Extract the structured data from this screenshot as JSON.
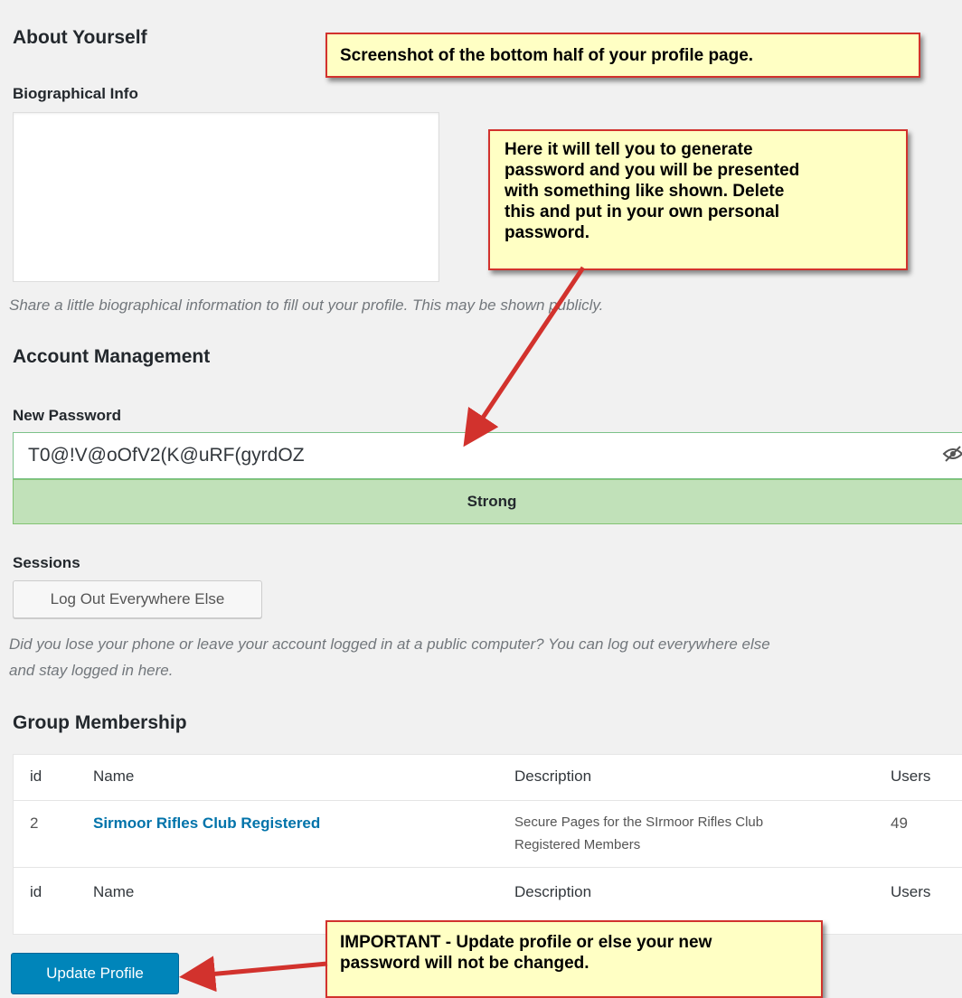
{
  "about": {
    "heading": "About Yourself",
    "bio_label": "Biographical Info",
    "bio_value": "",
    "bio_description": "Share a little biographical information to fill out your profile. This may be shown publicly."
  },
  "account": {
    "heading": "Account Management",
    "password_label": "New Password",
    "password_value": "T0@!V@oOfV2(K@uRF(gyrdOZ",
    "strength": "Strong",
    "sessions_label": "Sessions",
    "logout_button": "Log Out Everywhere Else",
    "sessions_description_line1": "Did you lose your phone or leave your account logged in at a public computer? You can log out everywhere else",
    "sessions_description_line2": "and stay logged in here."
  },
  "group": {
    "heading": "Group Membership",
    "columns": [
      "id",
      "Name",
      "Description",
      "Users"
    ],
    "rows": [
      {
        "id": "2",
        "name": "Sirmoor Rifles Club Registered",
        "description_line1": "Secure Pages for the SIrmoor Rifles Club",
        "description_line2": "Registered Members",
        "users": "49"
      }
    ],
    "footer": [
      "id",
      "Name",
      "Description",
      "Users"
    ]
  },
  "update_button": "Update Profile",
  "callouts": {
    "top": "Screenshot of the bottom half of your profile page.",
    "middle_line1": "Here it will tell you to generate",
    "middle_line2": "password and you will be presented",
    "middle_line3": "with something like shown.  Delete",
    "middle_line4": "this and put in your own personal",
    "middle_line5": "password.",
    "bottom_line1": "IMPORTANT - Update profile or else your new",
    "bottom_line2": "password will not be changed."
  },
  "colors": {
    "annotation_border": "#d2322d",
    "annotation_fill": "#ffffc4",
    "primary_button": "#0085ba",
    "strength_fill": "#c1e1b9"
  },
  "icons": {
    "password_toggle": "eye-slash-icon"
  }
}
